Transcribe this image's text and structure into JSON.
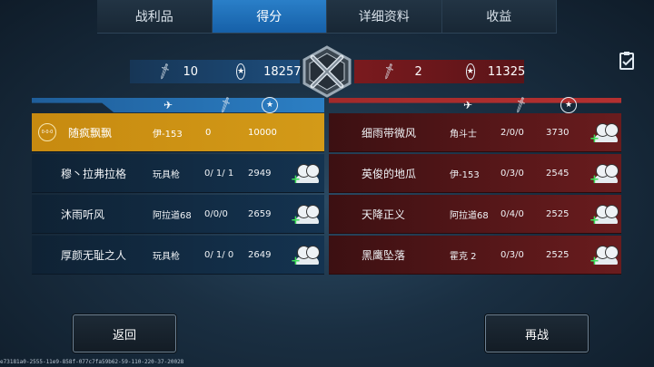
{
  "tabs": [
    {
      "label": "战利品"
    },
    {
      "label": "得分"
    },
    {
      "label": "详细资料"
    },
    {
      "label": "收益"
    }
  ],
  "blue_team": {
    "kills": "10",
    "score": "18257"
  },
  "red_team": {
    "kills": "2",
    "score": "11325"
  },
  "blue_rows": [
    {
      "name": "随疯飘飘",
      "weapon": "伊-153",
      "kda": "0",
      "score": "10000",
      "badge": "0·0·0"
    },
    {
      "name": "穆丶拉弗拉格",
      "weapon": "玩具枪",
      "kda": "0/ 1/ 1",
      "score": "2949"
    },
    {
      "name": "沐雨听风",
      "weapon": "阿拉道68",
      "kda": "0/0/0",
      "score": "2659"
    },
    {
      "name": "厚颜无耻之人",
      "weapon": "玩具枪",
      "kda": "0/ 1/ 0",
      "score": "2649"
    }
  ],
  "red_rows": [
    {
      "name": "细雨带微风",
      "weapon": "角斗士",
      "kda": "2/0/0",
      "score": "3730"
    },
    {
      "name": "英俊的地瓜",
      "weapon": "伊-153",
      "kda": "0/3/0",
      "score": "2545"
    },
    {
      "name": "天降正义",
      "weapon": "阿拉道68",
      "kda": "0/4/0",
      "score": "2525"
    },
    {
      "name": "黑鹰坠落",
      "weapon": "霍克 2",
      "kda": "0/3/0",
      "score": "2525"
    }
  ],
  "buttons": {
    "back": "返回",
    "rematch": "再战"
  },
  "footer": "e73181a0-2555-11e9-858f-077c7fa59b62-59-110-220-37-20028",
  "colors": {
    "blue_accent": "#2c7fc4",
    "red_accent": "#b43030",
    "gold_row": "#d39a18"
  },
  "icons": {
    "plane": "plane-icon",
    "sword": "sword-icon",
    "star": "star-medal-icon",
    "friend": "add-friend-icon",
    "clipboard": "clipboard-icon"
  }
}
